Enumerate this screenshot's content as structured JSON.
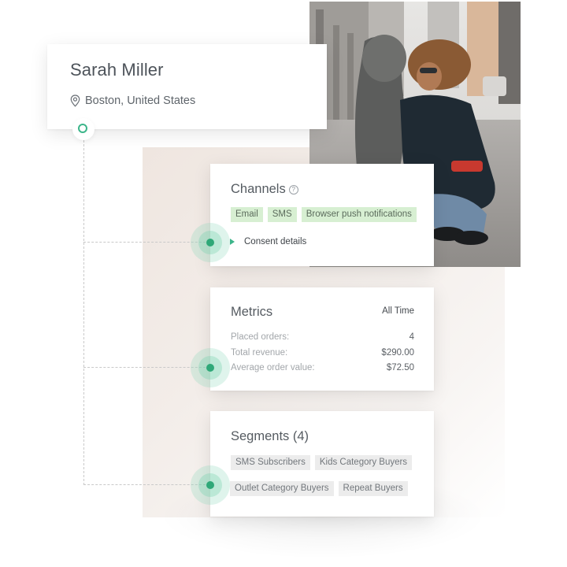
{
  "profile": {
    "name": "Sarah Miller",
    "location": "Boston, United States",
    "location_icon": "map-pin-icon"
  },
  "photo": {
    "description": "Woman with curly hair and sunglasses kneeling on a city street with a child in a grey hooded jacket"
  },
  "channels": {
    "title": "Channels",
    "help_icon": "question-circle-icon",
    "help_glyph": "?",
    "chips": [
      "Email",
      "SMS",
      "Browser push notifications"
    ],
    "consent_label": "Consent details",
    "consent_icon": "triangle-right-icon"
  },
  "metrics": {
    "title": "Metrics",
    "range": "All Time",
    "rows": [
      {
        "label": "Placed orders:",
        "value": "4"
      },
      {
        "label": "Total revenue:",
        "value": "$290.00"
      },
      {
        "label": "Average order value:",
        "value": "$72.50"
      }
    ]
  },
  "segments": {
    "title": "Segments (4)",
    "chips": [
      "SMS Subscribers",
      "Kids Category Buyers",
      "Outlet Category Buyers",
      "Repeat Buyers"
    ]
  },
  "colors": {
    "accent": "#2fa878",
    "chip_green": "#d7efd2",
    "chip_grey": "#ececec",
    "text_primary": "#4d535a"
  }
}
